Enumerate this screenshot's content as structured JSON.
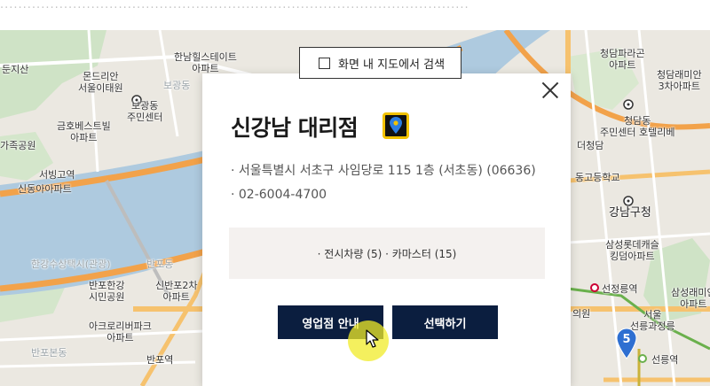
{
  "search_toggle": {
    "label": "화면 내 지도에서 검색",
    "checked": false
  },
  "dealer": {
    "name": "신강남 대리점",
    "address": "· 서울특별시 서초구 사임당로 115 1층 (서초동) (06636)",
    "phone": "· 02-6004-4700",
    "stock": "· 전시차량 (5) · 카마스터 (15)"
  },
  "buttons": {
    "sales_info": "영업점 안내",
    "select": "선택하기"
  },
  "map": {
    "cluster_count": "5",
    "labels": {
      "dunjisan": "둔지산",
      "mondrian": "몬드리안\n서울이태원",
      "bogwang": "보광동\n주민센터",
      "hannam_hills": "한남힐스테이트\n아파트",
      "kumho": "금호베스트빌\n아파트",
      "jeongsu_park": "가족공원",
      "sinyongsan_gate": "서빙고역",
      "sindong": "신동아아파트",
      "cheongdam_park": "청담파라곤\n아파트",
      "cheongdam_3": "청담래미안\n3차아파트",
      "cheongdam_center": "청담동\n주민센터 호텔리베",
      "deocheongdam": "더청담",
      "godung": "동고등학교",
      "gangnamgu": "강남구청",
      "samsung_lotte": "삼성롯데캐슬\n킹덤아파트",
      "seonjeongneung": "선정릉역",
      "samsung_apt": "삼성래미안\n아파트",
      "seolleung_royal": "서울\n선릉과정릉",
      "uiwon": "의원",
      "seolleung_station": "선릉역",
      "banpo_hangang": "반포한강\n시민공원",
      "sinbanpo": "신반포2차\n아파트",
      "acro": "아크로리버파크\n아파트",
      "banpo_bondong": "반포본동",
      "banpo_station": "반포역",
      "bogwang_dong": "보광동",
      "banpo_dong": "반포동",
      "hangang_road": "한강수상택시(관광)"
    }
  }
}
